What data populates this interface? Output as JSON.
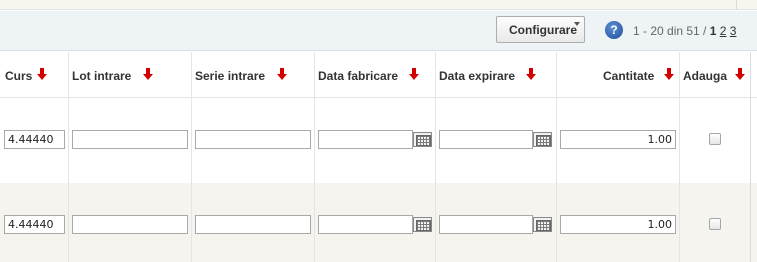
{
  "toolbar": {
    "configure_label": "Configurare",
    "help_icon": "question-circle-icon",
    "pager": {
      "range_text": "1 - 20 din 51 /",
      "current_page": "1",
      "pages": [
        "2",
        "3"
      ]
    }
  },
  "columns": {
    "curs": "Curs",
    "lot_intrare": "Lot intrare",
    "serie_intrare": "Serie intrare",
    "data_fabricare": "Data fabricare",
    "data_expirare": "Data expirare",
    "cantitate": "Cantitate",
    "adauga": "Adauga"
  },
  "sort_icon": "sort-down-arrow-icon",
  "calendar_icon": "calendar-icon",
  "rows": [
    {
      "curs": "4.44440",
      "lot_intrare": "",
      "serie_intrare": "",
      "data_fabricare": "",
      "data_expirare": "",
      "cantitate": "1.00",
      "adauga": false
    },
    {
      "curs": "4.44440",
      "lot_intrare": "",
      "serie_intrare": "",
      "data_fabricare": "",
      "data_expirare": "",
      "cantitate": "1.00",
      "adauga": false
    }
  ],
  "colors": {
    "sort_arrow": "#d40000",
    "toolbar_bg": "#eef3f6",
    "alt_row_bg": "#f6f4ef"
  }
}
